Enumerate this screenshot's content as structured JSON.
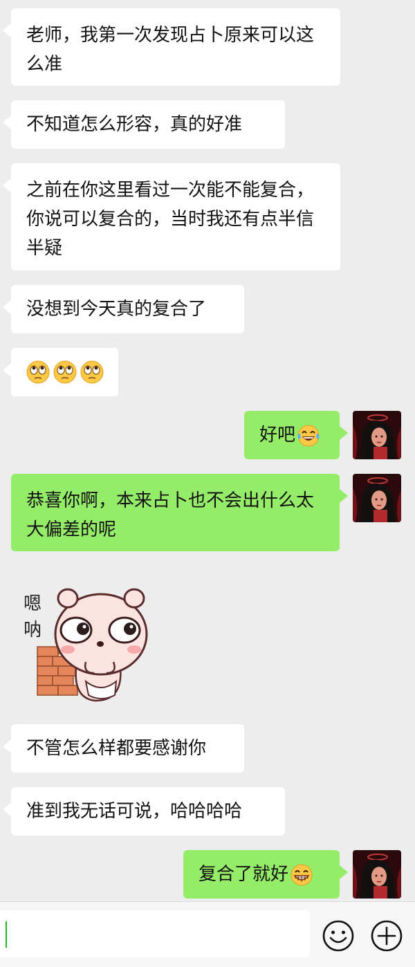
{
  "messages": [
    {
      "side": "left",
      "text": "老师，我第一次发现占卜原来可以这么准"
    },
    {
      "side": "left",
      "text": "不知道怎么形容，真的好准"
    },
    {
      "side": "left",
      "text": "之前在你这里看过一次能不能复合，你说可以复合的，当时我还有点半信半疑"
    },
    {
      "side": "left",
      "text": "没想到今天真的复合了"
    },
    {
      "side": "left",
      "emoji": [
        "rolling-eyes-emoji",
        "rolling-eyes-emoji",
        "rolling-eyes-emoji"
      ]
    },
    {
      "side": "right",
      "text": "好吧",
      "emoji": "laugh-tears-emoji"
    },
    {
      "side": "right",
      "text": "恭喜你啊，本来占卜也不会出什么太大偏差的呢"
    },
    {
      "side": "left",
      "sticker": "pig-sticker",
      "sticker_text": "嗯呐"
    },
    {
      "side": "left",
      "text": "不管怎么样都要感谢你"
    },
    {
      "side": "left",
      "text": "准到我无话可说，哈哈哈哈"
    },
    {
      "side": "right",
      "text": "复合了就好",
      "emoji": "grin-emoji"
    }
  ],
  "input": {
    "value": ""
  },
  "colors": {
    "background": "#ededed",
    "left_bubble": "#ffffff",
    "right_bubble": "#95ec69",
    "cursor": "#18b818"
  },
  "icons": [
    "emoji-face-icon",
    "plus-circle-icon"
  ]
}
